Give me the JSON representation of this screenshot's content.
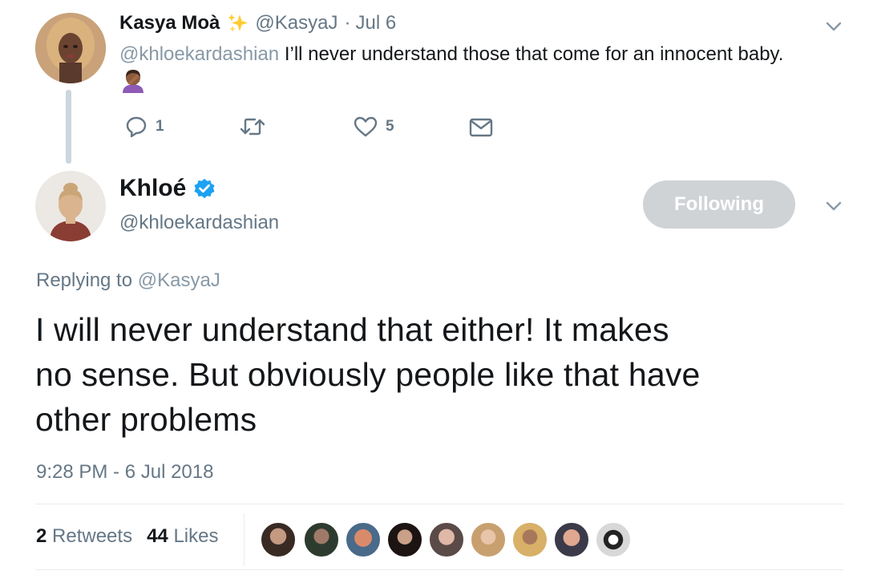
{
  "reply_tweet": {
    "display_name": "Kasya Moà",
    "badge_emoji": "sparkles",
    "handle": "@KasyaJ",
    "separator": "·",
    "date": "Jul 6",
    "mention": "@khloekardashian",
    "text": "I’ll never understand those that come for an innocent baby.",
    "emoji": "facepalm",
    "actions": {
      "reply_count": "1",
      "retweet_count": "",
      "like_count": "5"
    }
  },
  "main_tweet": {
    "display_name": "Khloé",
    "verified": true,
    "handle": "@khloekardashian",
    "follow_button": "Following",
    "replying_prefix": "Replying to",
    "replying_to": "@KasyaJ",
    "text_lines": [
      "I will never understand that either! It makes",
      "no sense. But obviously people like that have",
      "other problems"
    ],
    "timestamp": "9:28 PM - 6 Jul 2018",
    "retweets_count": "2",
    "retweets_label": "Retweets",
    "likes_count": "44",
    "likes_label": "Likes",
    "liker_avatar_count": 9
  },
  "colors": {
    "link_blue": "#1da1f2",
    "muted_gray": "#657786",
    "following_bg": "#d0d3d6",
    "verified_blue": "#1da1f2"
  }
}
